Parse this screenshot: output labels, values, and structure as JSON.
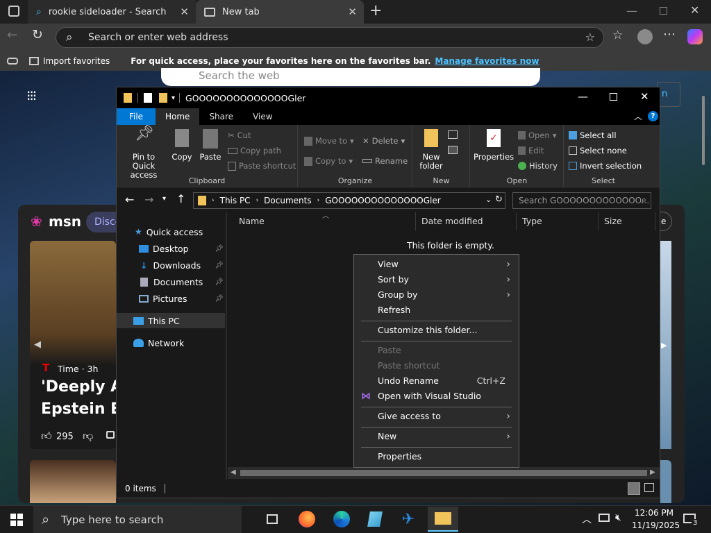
{
  "browser": {
    "tabs": [
      {
        "title": "rookie sideloader - Search"
      },
      {
        "title": "New tab"
      }
    ],
    "address_placeholder": "Search or enter web address",
    "favorites_bar": {
      "import_label": "Import favorites",
      "message": "For quick access, place your favorites here on the favorites bar.",
      "manage_link": "Manage favorites now"
    },
    "page": {
      "search_placeholder": "Search the web",
      "signin_fragment": "n",
      "msn_logo": "msn",
      "discover_fragment": "Disco",
      "news_source": "Time",
      "news_age": "3h",
      "headline_line1": "'Deeply As",
      "headline_line2": "Epstein En",
      "likes": "295",
      "badge_fragment": "e"
    }
  },
  "explorer": {
    "title": "GOOOOOOOOOOOOOOGler",
    "ribbon_tabs": [
      "File",
      "Home",
      "Share",
      "View"
    ],
    "clipboard": {
      "pin": "Pin to Quick access",
      "copy": "Copy",
      "paste": "Paste",
      "cut": "Cut",
      "copy_path": "Copy path",
      "paste_shortcut": "Paste shortcut",
      "group": "Clipboard"
    },
    "organize": {
      "move_to": "Move to",
      "copy_to": "Copy to",
      "delete": "Delete",
      "rename": "Rename",
      "group": "Organize"
    },
    "new": {
      "new_folder": "New folder",
      "group": "New"
    },
    "open": {
      "properties": "Properties",
      "open": "Open",
      "edit": "Edit",
      "history": "History",
      "group": "Open"
    },
    "select": {
      "select_all": "Select all",
      "select_none": "Select none",
      "invert": "Invert selection",
      "group": "Select"
    },
    "breadcrumb": [
      "This PC",
      "Documents",
      "GOOOOOOOOOOOOOOGler"
    ],
    "search_placeholder": "Search GOOOOOOOOOOOOO...",
    "nav_pane": {
      "quick_access": "Quick access",
      "items": [
        "Desktop",
        "Downloads",
        "Documents",
        "Pictures"
      ],
      "this_pc": "This PC",
      "network": "Network"
    },
    "columns": [
      "Name",
      "Date modified",
      "Type",
      "Size"
    ],
    "empty_message": "This folder is empty.",
    "status": "0 items"
  },
  "context_menu": {
    "items": [
      {
        "label": "View",
        "submenu": true
      },
      {
        "label": "Sort by",
        "submenu": true
      },
      {
        "label": "Group by",
        "submenu": true
      },
      {
        "label": "Refresh"
      },
      {
        "label": "Customize this folder..."
      },
      {
        "label": "Paste",
        "disabled": true
      },
      {
        "label": "Paste shortcut",
        "disabled": true
      },
      {
        "label": "Undo Rename",
        "shortcut": "Ctrl+Z"
      },
      {
        "label": "Open with Visual Studio"
      },
      {
        "label": "Give access to",
        "submenu": true
      },
      {
        "label": "New",
        "submenu": true
      },
      {
        "label": "Properties"
      }
    ]
  },
  "taskbar": {
    "search_placeholder": "Type here to search",
    "time": "12:06 PM",
    "date": "11/19/2025",
    "notifications": "3"
  },
  "colors": {
    "accent": "#0078d4",
    "link": "#4cc2ff",
    "explorer_bg": "#191919"
  }
}
